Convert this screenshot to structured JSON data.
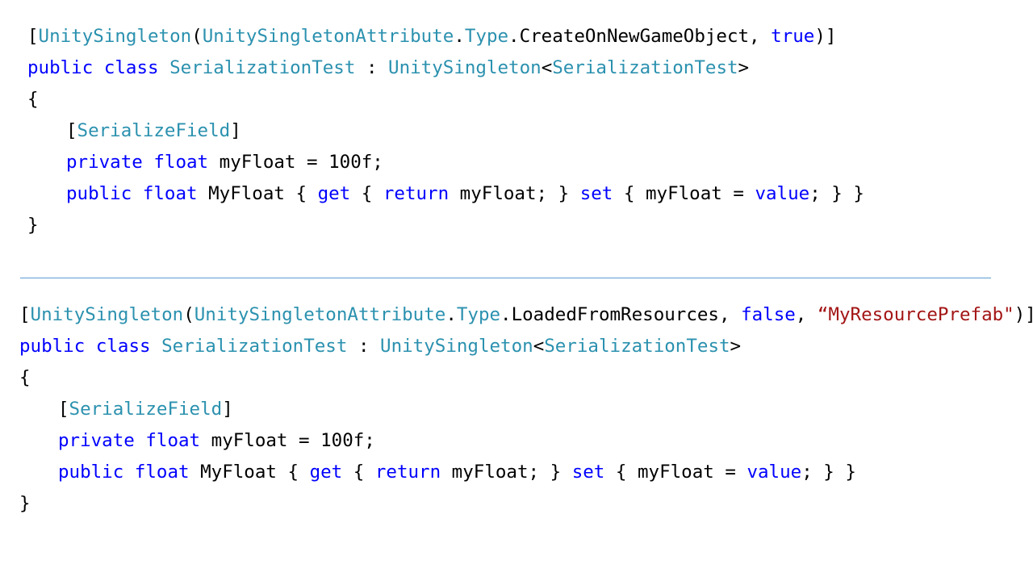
{
  "colors": {
    "keyword": "#0000ff",
    "type": "#2b91af",
    "string": "#a31515",
    "text": "#000000",
    "divider": "#5b9bd5"
  },
  "snippets": [
    {
      "lines": [
        [
          {
            "t": "[",
            "c": "pl"
          },
          {
            "t": "UnitySingleton",
            "c": "ty"
          },
          {
            "t": "(",
            "c": "pl"
          },
          {
            "t": "UnitySingletonAttribute",
            "c": "ty"
          },
          {
            "t": ".",
            "c": "pl"
          },
          {
            "t": "Type",
            "c": "ty"
          },
          {
            "t": ".CreateOnNewGameObject, ",
            "c": "pl"
          },
          {
            "t": "true",
            "c": "kw"
          },
          {
            "t": ")]",
            "c": "pl"
          }
        ],
        [
          {
            "t": "public",
            "c": "kw"
          },
          {
            "t": " ",
            "c": "pl"
          },
          {
            "t": "class",
            "c": "kw"
          },
          {
            "t": " ",
            "c": "pl"
          },
          {
            "t": "SerializationTest",
            "c": "ty"
          },
          {
            "t": " : ",
            "c": "pl"
          },
          {
            "t": "UnitySingleton",
            "c": "ty"
          },
          {
            "t": "<",
            "c": "pl"
          },
          {
            "t": "SerializationTest",
            "c": "ty"
          },
          {
            "t": ">",
            "c": "pl"
          }
        ],
        [
          {
            "t": "{",
            "c": "pl"
          }
        ],
        [
          {
            "t": "[",
            "c": "pl"
          },
          {
            "t": "SerializeField",
            "c": "ty"
          },
          {
            "t": "]",
            "c": "pl"
          }
        ],
        [
          {
            "t": "private",
            "c": "kw"
          },
          {
            "t": " ",
            "c": "pl"
          },
          {
            "t": "float",
            "c": "kw"
          },
          {
            "t": " myFloat = 100f;",
            "c": "pl"
          }
        ],
        [
          {
            "t": "public",
            "c": "kw"
          },
          {
            "t": " ",
            "c": "pl"
          },
          {
            "t": "float",
            "c": "kw"
          },
          {
            "t": " MyFloat { ",
            "c": "pl"
          },
          {
            "t": "get",
            "c": "kw"
          },
          {
            "t": " { ",
            "c": "pl"
          },
          {
            "t": "return",
            "c": "kw"
          },
          {
            "t": " myFloat; } ",
            "c": "pl"
          },
          {
            "t": "set",
            "c": "kw"
          },
          {
            "t": " { myFloat = ",
            "c": "pl"
          },
          {
            "t": "value",
            "c": "kw"
          },
          {
            "t": "; } }",
            "c": "pl"
          }
        ],
        [
          {
            "t": "}",
            "c": "pl"
          }
        ]
      ]
    },
    {
      "lines": [
        [
          {
            "t": "[",
            "c": "pl"
          },
          {
            "t": "UnitySingleton",
            "c": "ty"
          },
          {
            "t": "(",
            "c": "pl"
          },
          {
            "t": "UnitySingletonAttribute",
            "c": "ty"
          },
          {
            "t": ".",
            "c": "pl"
          },
          {
            "t": "Type",
            "c": "ty"
          },
          {
            "t": ".LoadedFromResources, ",
            "c": "pl"
          },
          {
            "t": "false",
            "c": "kw"
          },
          {
            "t": ", ",
            "c": "pl"
          },
          {
            "t": "“MyResourcePrefab\"",
            "c": "st"
          },
          {
            "t": ")]",
            "c": "pl"
          }
        ],
        [
          {
            "t": "public",
            "c": "kw"
          },
          {
            "t": " ",
            "c": "pl"
          },
          {
            "t": "class",
            "c": "kw"
          },
          {
            "t": " ",
            "c": "pl"
          },
          {
            "t": "SerializationTest",
            "c": "ty"
          },
          {
            "t": " : ",
            "c": "pl"
          },
          {
            "t": "UnitySingleton",
            "c": "ty"
          },
          {
            "t": "<",
            "c": "pl"
          },
          {
            "t": "SerializationTest",
            "c": "ty"
          },
          {
            "t": ">",
            "c": "pl"
          }
        ],
        [
          {
            "t": "{",
            "c": "pl"
          }
        ],
        [
          {
            "t": "[",
            "c": "pl"
          },
          {
            "t": "SerializeField",
            "c": "ty"
          },
          {
            "t": "]",
            "c": "pl"
          }
        ],
        [
          {
            "t": "private",
            "c": "kw"
          },
          {
            "t": " ",
            "c": "pl"
          },
          {
            "t": "float",
            "c": "kw"
          },
          {
            "t": " myFloat = 100f;",
            "c": "pl"
          }
        ],
        [
          {
            "t": "public",
            "c": "kw"
          },
          {
            "t": " ",
            "c": "pl"
          },
          {
            "t": "float",
            "c": "kw"
          },
          {
            "t": " MyFloat { ",
            "c": "pl"
          },
          {
            "t": "get",
            "c": "kw"
          },
          {
            "t": " { ",
            "c": "pl"
          },
          {
            "t": "return",
            "c": "kw"
          },
          {
            "t": " myFloat; } ",
            "c": "pl"
          },
          {
            "t": "set",
            "c": "kw"
          },
          {
            "t": " { myFloat = ",
            "c": "pl"
          },
          {
            "t": "value",
            "c": "kw"
          },
          {
            "t": "; } }",
            "c": "pl"
          }
        ],
        [
          {
            "t": "}",
            "c": "pl"
          }
        ]
      ]
    }
  ]
}
